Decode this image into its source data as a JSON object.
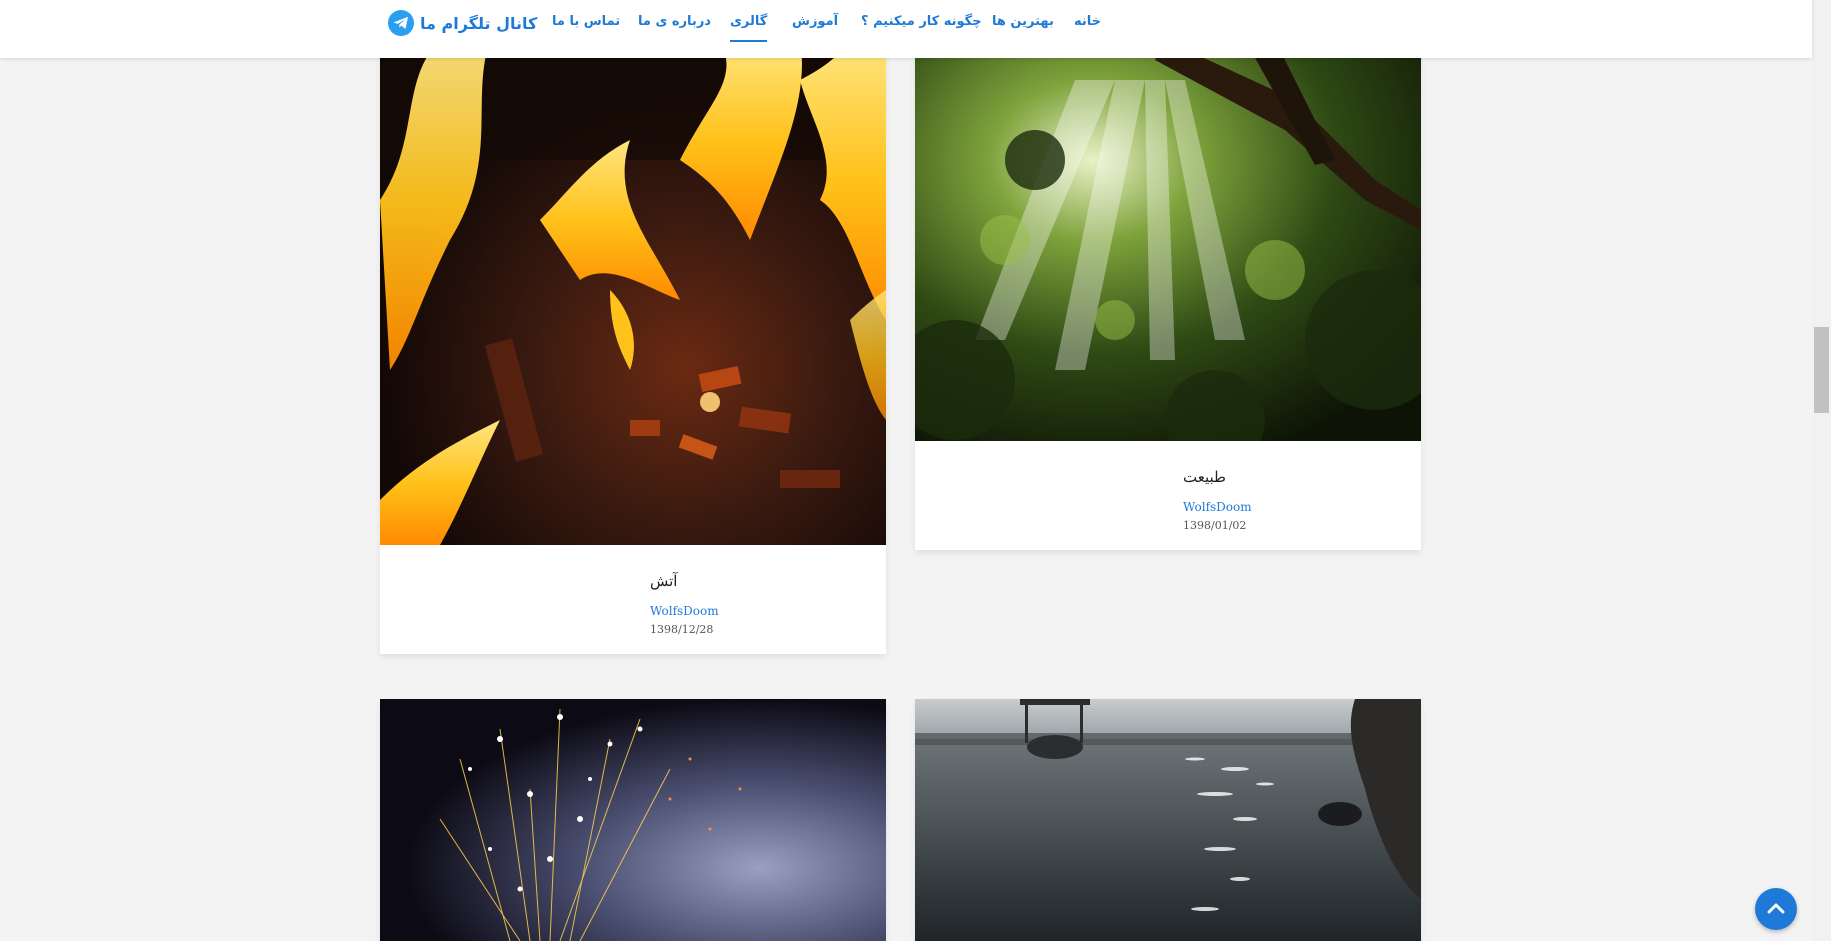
{
  "navbar": {
    "brand": "کانال تلگرام ما",
    "brand_icon": "telegram-icon",
    "links": [
      {
        "label": "خانه",
        "active": false
      },
      {
        "label": "بهترین ها",
        "active": false
      },
      {
        "label": "چگونه کار میکنیم ؟",
        "active": false
      },
      {
        "label": "آموزش",
        "active": false
      },
      {
        "label": "گالری",
        "active": true
      },
      {
        "label": "درباره ی ما",
        "active": false
      },
      {
        "label": "تماس با ما",
        "active": false
      }
    ],
    "accent_color": "#1e7ad8"
  },
  "gallery": {
    "cards": [
      {
        "title": "آتش",
        "author": "WolfsDoom",
        "date": "1398/12/28",
        "image": "fire-photo"
      },
      {
        "title": "طبیعت",
        "author": "WolfsDoom",
        "date": "1398/01/02",
        "image": "forest-photo"
      },
      {
        "title": "",
        "author": "",
        "date": "",
        "image": "sparks-photo"
      },
      {
        "title": "",
        "author": "",
        "date": "",
        "image": "river-photo"
      }
    ]
  },
  "back_to_top_icon": "chevron-up-icon"
}
